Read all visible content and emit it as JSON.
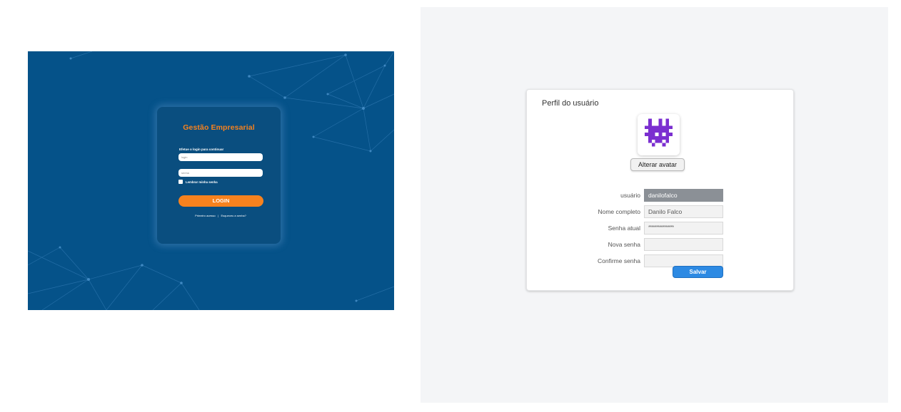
{
  "login": {
    "title": "Gestão Empresarial",
    "subtitle": "Efetue o login para continuar",
    "login_placeholder": "login",
    "password_placeholder": "senha",
    "remember_label": "Lembrar minha senha",
    "button_label": "LOGIN",
    "link_first_access": "Primeiro acesso",
    "link_separator": "|",
    "link_forgot": "Esqueceu a senha?",
    "colors": {
      "background": "#055289",
      "accent": "#f7821e"
    }
  },
  "profile": {
    "title": "Perfil do usuário",
    "avatar_icon": "pixel-avatar-icon",
    "change_avatar_label": "Alterar avatar",
    "fields": {
      "username": {
        "label": "usuário",
        "value": "danilofalco"
      },
      "full_name": {
        "label": "Nome completo",
        "value": "Danilo Falco"
      },
      "current_password": {
        "label": "Senha atual",
        "value": "****************"
      },
      "new_password": {
        "label": "Nova senha",
        "value": ""
      },
      "confirm_password": {
        "label": "Confirme senha",
        "value": ""
      }
    },
    "save_label": "Salvar",
    "colors": {
      "save": "#2d8ae3",
      "avatar": "#7b2fd0"
    }
  }
}
